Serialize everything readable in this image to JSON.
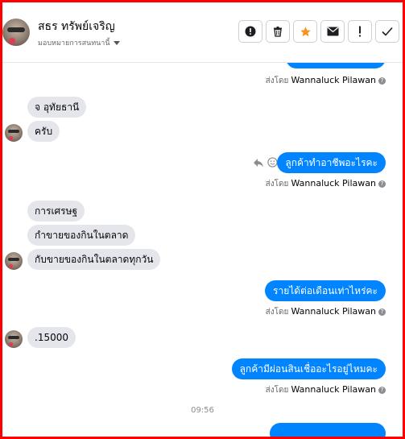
{
  "contact": {
    "name": "สธร ทรัพย์เจริญ",
    "status": "มอบหมายการสนทนานี้"
  },
  "actions": [
    {
      "name": "report-icon"
    },
    {
      "name": "trash-icon"
    },
    {
      "name": "star-icon"
    },
    {
      "name": "envelope-icon"
    },
    {
      "name": "exclamation-icon"
    },
    {
      "name": "check-icon"
    }
  ],
  "sender_prefix": "ส่งโดย",
  "sender_name": "Wannaluck Pilawan",
  "messages": {
    "in1": "จ อุทัยธานี",
    "in2": "ครับ",
    "out1": "ลูกค้าทำอาชีพอะไรคะ",
    "in3": "การเศรษฐ",
    "in4": "กำขายของกินในตลาด",
    "in5": "กับขายของกินในตลาดทุกวัน",
    "out2": "รายได้ต่อเดือนเท่าไหร่คะ",
    "in6": ".15000",
    "out3": "ลูกค้ามีผ่อนสินเชื่ออะไรอยู่ไหมคะ"
  },
  "time_divider": "09:56",
  "colors": {
    "accent": "#0084ff",
    "star": "#f7931e",
    "frame": "#ff0000",
    "incoming_bubble": "#e4e6eb"
  }
}
